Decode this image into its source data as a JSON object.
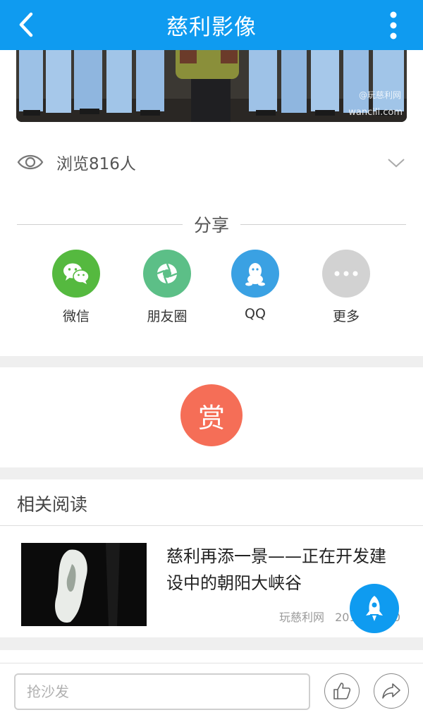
{
  "header": {
    "title": "慈利影像",
    "back_icon": "chevron-left-icon",
    "menu_icon": "more-vertical-icon",
    "color": "#0f9bf0"
  },
  "photo": {
    "watermark_line1": "@玩慈利网",
    "watermark_line2": "wancili.com"
  },
  "views": {
    "text": "浏览816人",
    "icon": "eye-icon"
  },
  "share": {
    "title": "分享",
    "items": [
      {
        "label": "微信",
        "icon": "wechat-icon",
        "color": "#55b93f"
      },
      {
        "label": "朋友圈",
        "icon": "moments-icon",
        "color": "#5cbf87"
      },
      {
        "label": "QQ",
        "icon": "qq-icon",
        "color": "#3aa1e3"
      },
      {
        "label": "更多",
        "icon": "more-horizontal-icon",
        "color": "#d2d2d2"
      }
    ]
  },
  "reward": {
    "label": "赏",
    "color": "#f56e57"
  },
  "related": {
    "title": "相关阅读",
    "articles": [
      {
        "title": "慈利再添一景——正在开发建设中的朝阳大峡谷",
        "source": "玩慈利网",
        "date": "2012-09-10"
      }
    ]
  },
  "bottom": {
    "comment_placeholder": "抢沙发",
    "like_icon": "thumbs-up-icon",
    "share_icon": "share-arrow-icon"
  }
}
